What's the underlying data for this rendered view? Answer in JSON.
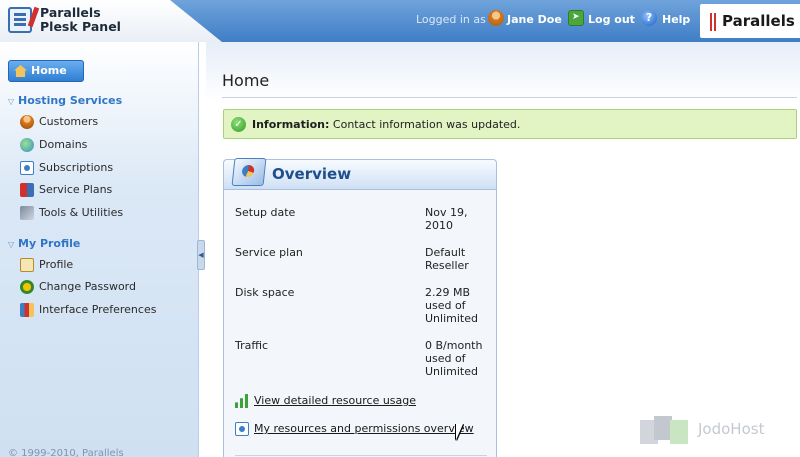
{
  "header": {
    "product_line1": "Parallels",
    "product_line2": "Plesk Panel",
    "logged_in_as": "Logged in as",
    "user_name": "Jane Doe",
    "logout_label": "Log out",
    "help_label": "Help",
    "brand_name": "Parallels"
  },
  "sidebar": {
    "home_label": "Home",
    "sections": [
      {
        "title": "Hosting Services",
        "items": [
          {
            "label": "Customers",
            "icon": "customers-icon"
          },
          {
            "label": "Domains",
            "icon": "domains-icon"
          },
          {
            "label": "Subscriptions",
            "icon": "subscriptions-icon"
          },
          {
            "label": "Service Plans",
            "icon": "service-plans-icon"
          },
          {
            "label": "Tools & Utilities",
            "icon": "tools-icon"
          }
        ]
      },
      {
        "title": "My Profile",
        "items": [
          {
            "label": "Profile",
            "icon": "profile-icon"
          },
          {
            "label": "Change Password",
            "icon": "change-password-icon"
          },
          {
            "label": "Interface Preferences",
            "icon": "interface-preferences-icon"
          }
        ]
      }
    ],
    "copyright": "© 1999-2010, Parallels"
  },
  "main": {
    "page_title": "Home",
    "info": {
      "label": "Information:",
      "message": "Contact information was updated."
    },
    "overview": {
      "title": "Overview",
      "rows": [
        {
          "label": "Setup date",
          "value_lines": [
            "Nov 19,",
            "2010"
          ]
        },
        {
          "label": "Service plan",
          "value_lines": [
            "Default",
            "Reseller"
          ]
        },
        {
          "label": "Disk space",
          "value_lines": [
            "2.29 MB",
            "used of",
            "Unlimited"
          ]
        },
        {
          "label": "Traffic",
          "value_lines": [
            "0 B/month",
            "used of",
            "Unlimited"
          ]
        }
      ],
      "links": [
        {
          "label": "View detailed resource usage",
          "icon": "chart-icon"
        },
        {
          "label": "My resources and permissions overview",
          "icon": "permissions-icon"
        }
      ]
    }
  },
  "watermark": {
    "text": "JodoHost"
  },
  "colors": {
    "header_blue": "#3f7ec6",
    "section_title": "#2f76c6",
    "info_bg": "#e2f4c4",
    "overview_title": "#1f4f8a",
    "brand_red": "#d0312d"
  }
}
